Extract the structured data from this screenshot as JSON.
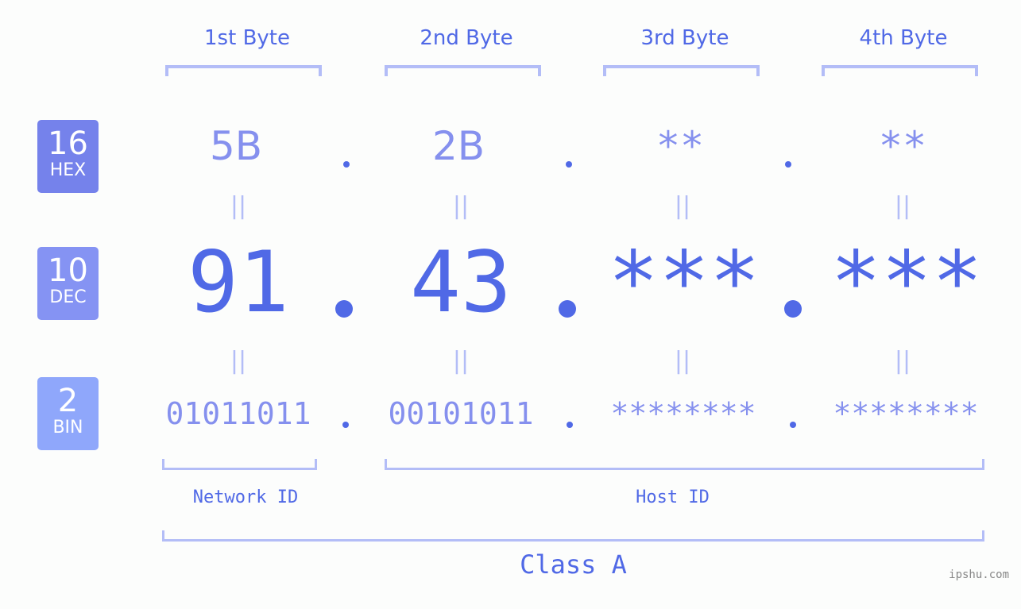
{
  "bytes": [
    {
      "title": "1st Byte",
      "hex": "5B",
      "dec": "91",
      "bin": "01011011"
    },
    {
      "title": "2nd Byte",
      "hex": "2B",
      "dec": "43",
      "bin": "00101011"
    },
    {
      "title": "3rd Byte",
      "hex": "**",
      "dec": "***",
      "bin": "********"
    },
    {
      "title": "4th Byte",
      "hex": "**",
      "dec": "***",
      "bin": "********"
    }
  ],
  "badges": {
    "hex": {
      "num": "16",
      "label": "HEX",
      "color": "#7582eb"
    },
    "dec": {
      "num": "10",
      "label": "DEC",
      "color": "#8593f3"
    },
    "bin": {
      "num": "2",
      "label": "BIN",
      "color": "#8fa7fb"
    }
  },
  "equals_symbol": "||",
  "labels": {
    "network_id": "Network ID",
    "host_id": "Host ID",
    "class": "Class A"
  },
  "watermark": "ipshu.com",
  "colors": {
    "primary": "#5069e6",
    "secondary": "#8590ee",
    "bracket": "#b3bdf7"
  }
}
